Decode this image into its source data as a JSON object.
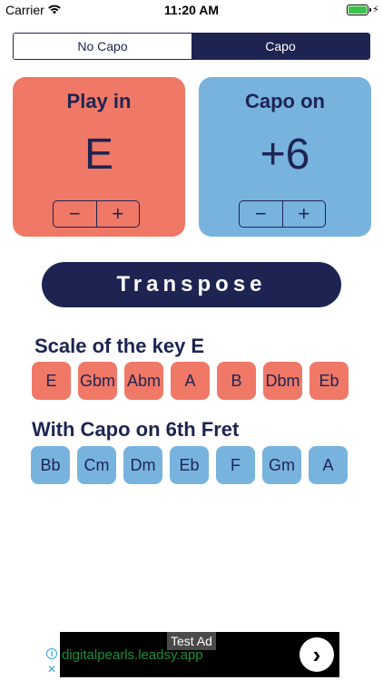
{
  "status_bar": {
    "carrier": "Carrier",
    "time": "11:20 AM",
    "wifi_icon": "wifi-icon",
    "battery_icon": "battery-full-icon",
    "charging_icon": "charging-bolt-icon"
  },
  "mode_tabs": {
    "no_capo": "No Capo",
    "capo": "Capo",
    "selected": "Capo"
  },
  "play_card": {
    "title": "Play in",
    "value": "E",
    "minus": "−",
    "plus": "+",
    "color": "#f07866"
  },
  "capo_card": {
    "title": "Capo on",
    "value": "+6",
    "minus": "−",
    "plus": "+",
    "color": "#78b3de"
  },
  "transpose_button": "Transpose",
  "scale_section": {
    "heading": "Scale of the key E",
    "notes": [
      "E",
      "Gbm",
      "Abm",
      "A",
      "B",
      "Dbm",
      "Eb"
    ]
  },
  "capo_section": {
    "heading": "With Capo on 6th Fret",
    "notes": [
      "Bb",
      "Cm",
      "Dm",
      "Eb",
      "F",
      "Gm",
      "A"
    ]
  },
  "ad": {
    "label": "Test Ad",
    "url": "digitalpearls.leadsy.app",
    "next": "›"
  },
  "colors": {
    "navy": "#1e2452",
    "coral": "#f07866",
    "sky": "#78b3de"
  }
}
